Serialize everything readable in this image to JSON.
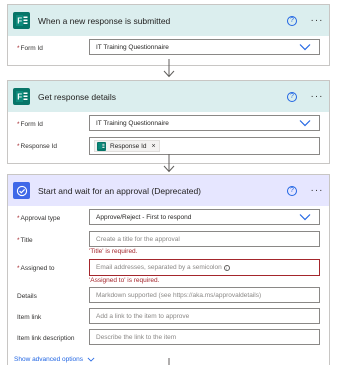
{
  "card1": {
    "title": "When a new response is submitted",
    "help": "?",
    "more": "···",
    "form_id_label": "Form Id",
    "form_id_value": "IT Training Questionnaire"
  },
  "card2": {
    "title": "Get response details",
    "help": "?",
    "more": "···",
    "form_id_label": "Form Id",
    "form_id_value": "IT Training Questionnaire",
    "response_id_label": "Response Id",
    "response_id_token": "Response Id",
    "token_remove": "×"
  },
  "card3": {
    "title": "Start and wait for an approval (Deprecated)",
    "help": "?",
    "more": "···",
    "approval_type_label": "Approval type",
    "approval_type_value": "Approve/Reject - First to respond",
    "title_label": "Title",
    "title_placeholder": "Create a title for the approval",
    "title_error": "'Title' is required.",
    "assigned_label": "Assigned to",
    "assigned_placeholder": "Email addresses, separated by a semicolon",
    "assigned_info": "i",
    "assigned_error": "'Assigned to' is required.",
    "details_label": "Details",
    "details_placeholder": "Markdown supported (see https://aka.ms/approvaldetails)",
    "item_link_label": "Item link",
    "item_link_placeholder": "Add a link to the item to approve",
    "item_link_desc_label": "Item link description",
    "item_link_desc_placeholder": "Describe the link to the item",
    "show_advanced": "Show advanced options"
  },
  "required_marker": "*",
  "colors": {
    "forms_header": "#dbeeee",
    "forms_icon": "#077568",
    "approval_header": "#e6e6ff",
    "approval_icon": "#3f68e8",
    "error": "#a4262c",
    "link": "#2266e3"
  },
  "icons": {
    "forms": "forms-icon",
    "approval": "approval-icon",
    "help": "help-icon",
    "more": "more-options-icon",
    "chevron": "chevron-down-icon",
    "arrow": "arrow-down-icon"
  }
}
